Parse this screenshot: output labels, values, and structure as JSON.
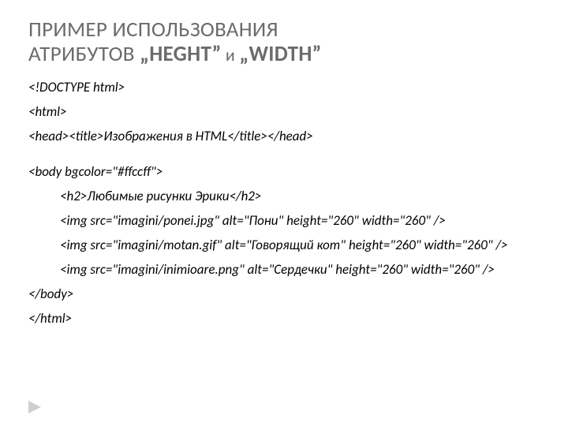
{
  "title": {
    "line1_a": "ПРИМЕР ИСПОЛЬЗОВАНИЯ",
    "line2_a": "АТРИБУТОВ ",
    "heght": "„HEGHT”",
    "and": " и ",
    "width": "„WIDTH”"
  },
  "code": {
    "l1": "<!DOCTYPE html>",
    "l2": "<html>",
    "l3": "<head><title>Изображения в HTML</title></head>",
    "l4": "<body bgcolor=\"#ffccff\">",
    "l5": "<h2>Любимые рисунки Эрики</h2>",
    "l6": "<img src=\"imagini/ponei.jpg\" alt=\"Пони\" height=\"260\" width=\"260\" />",
    "l7": "<img src=\"imagini/motan.gif\" alt=\"Говорящий кот\" height=\"260\" width=\"260\" />",
    "l8": "<img src=\"imagini/inimioare.png\" alt=\"Сердечки\" height=\"260\" width=\"260\" />",
    "l9": "</body>",
    "l10": "</html>"
  }
}
